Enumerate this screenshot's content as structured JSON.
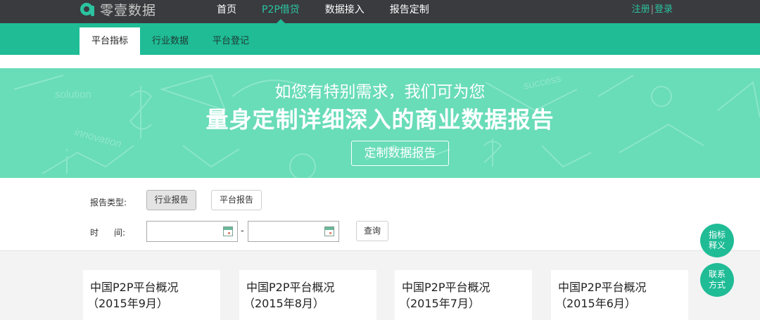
{
  "header": {
    "logo_text": "零壹数据",
    "nav": [
      {
        "label": "首页",
        "active": false
      },
      {
        "label": "P2P借贷",
        "active": true
      },
      {
        "label": "数据接入",
        "active": false
      },
      {
        "label": "报告定制",
        "active": false
      }
    ],
    "register": "注册",
    "separator": "|",
    "login": "登录"
  },
  "subnav": {
    "tabs": [
      {
        "label": "平台指标",
        "active": true
      },
      {
        "label": "行业数据",
        "active": false
      },
      {
        "label": "平台登记",
        "active": false
      }
    ]
  },
  "banner": {
    "line1": "如您有特别需求，我们可为您",
    "line2": "量身定制详细深入的商业数据报告",
    "button": "定制数据报告",
    "deco_words": [
      "solution",
      "innovation",
      "success"
    ]
  },
  "filters": {
    "type_label": "报告类型:",
    "type_options": [
      {
        "label": "行业报告",
        "selected": true
      },
      {
        "label": "平台报告",
        "selected": false
      }
    ],
    "time_label_1": "时",
    "time_label_2": "间:",
    "start_date": "",
    "end_date": "",
    "range_separator": "-",
    "query_button": "查询"
  },
  "cards": [
    {
      "title": "中国P2P平台概况",
      "period": "（2015年9月）"
    },
    {
      "title": "中国P2P平台概况",
      "period": "（2015年8月）"
    },
    {
      "title": "中国P2P平台概况",
      "period": "（2015年7月）"
    },
    {
      "title": "中国P2P平台概况",
      "period": "（2015年6月）"
    }
  ],
  "floating": {
    "glossary_1": "指标",
    "glossary_2": "释义",
    "contact_1": "联系",
    "contact_2": "方式"
  },
  "colors": {
    "accent": "#1fbc96",
    "banner": "#69dcb8",
    "topbar": "#3a3b3f"
  }
}
